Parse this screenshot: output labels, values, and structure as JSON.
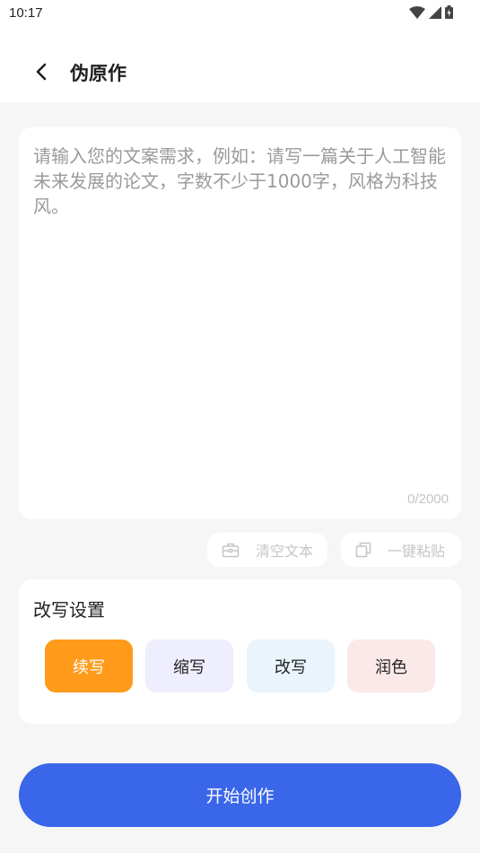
{
  "status_bar": {
    "time": "10:17",
    "icons": [
      "wifi-icon",
      "signal-icon",
      "battery-icon"
    ]
  },
  "header": {
    "title": "伪原作",
    "back_icon": "chevron-left-icon"
  },
  "input": {
    "placeholder": "请输入您的文案需求，例如：请写一篇关于人工智能未来发展的论文，字数不少于1000字，风格为科技风。",
    "value": "",
    "counter": "0/2000"
  },
  "actions": {
    "clear_label": "清空文本",
    "clear_icon": "briefcase-icon",
    "paste_label": "一键粘贴",
    "paste_icon": "copy-icon"
  },
  "settings": {
    "title": "改写设置",
    "modes": [
      {
        "label": "续写",
        "selected": true,
        "color": "#ff9a1b"
      },
      {
        "label": "缩写",
        "selected": false,
        "color": "#eeeefe"
      },
      {
        "label": "改写",
        "selected": false,
        "color": "#e9f4fc"
      },
      {
        "label": "润色",
        "selected": false,
        "color": "#fbe9e9"
      }
    ]
  },
  "primary_action": {
    "label": "开始创作",
    "color": "#3a66ea"
  }
}
